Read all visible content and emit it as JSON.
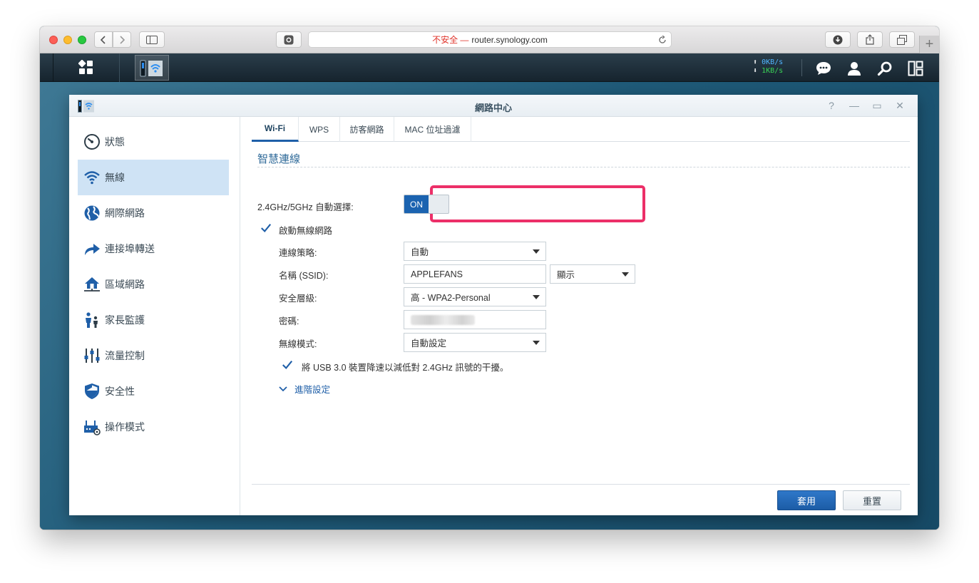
{
  "browser": {
    "url_insecure_label": "不安全 —",
    "url": "router.synology.com",
    "new_tab_label": "+"
  },
  "taskbar": {
    "upload_speed": "0KB/s",
    "download_speed": "1KB/s"
  },
  "app": {
    "title": "網路中心",
    "window_controls": {
      "help": "?",
      "minimize": "—",
      "maximize": "▭",
      "close": "✕"
    }
  },
  "sidebar": {
    "items": [
      {
        "label": "狀態",
        "icon": "gauge-icon"
      },
      {
        "label": "無線",
        "icon": "wifi-icon",
        "active": true
      },
      {
        "label": "網際網路",
        "icon": "globe-icon"
      },
      {
        "label": "連接埠轉送",
        "icon": "forward-arrow-icon"
      },
      {
        "label": "區域網路",
        "icon": "home-network-icon"
      },
      {
        "label": "家長監護",
        "icon": "family-icon"
      },
      {
        "label": "流量控制",
        "icon": "sliders-icon"
      },
      {
        "label": "安全性",
        "icon": "shield-icon"
      },
      {
        "label": "操作模式",
        "icon": "router-gear-icon"
      }
    ]
  },
  "tabs": [
    "Wi-Fi",
    "WPS",
    "訪客網路",
    "MAC 位址過濾"
  ],
  "smart_connect": {
    "section_title": "智慧連線",
    "label": "2.4GHz/5GHz 自動選擇:",
    "toggle_state": "ON"
  },
  "wireless": {
    "enable_label": "啟動無線網路",
    "enabled": true,
    "fields": {
      "strategy_label": "連線策略:",
      "strategy_value": "自動",
      "ssid_label": "名稱 (SSID):",
      "ssid_value": "APPLEFANS",
      "ssid_visibility": "顯示",
      "security_label": "安全層級:",
      "security_value": "高 - WPA2-Personal",
      "password_label": "密碼:",
      "mode_label": "無線模式:",
      "mode_value": "自動設定"
    },
    "usb_option_label": "將 USB 3.0 裝置降速以減低對 2.4GHz 訊號的干擾。",
    "usb_option_checked": true,
    "advanced_label": "進階設定"
  },
  "buttons": {
    "apply": "套用",
    "reset": "重置"
  },
  "colors": {
    "accent": "#1f5fa8",
    "highlight_box": "#ec2f68",
    "active_nav": "#cfe3f5"
  }
}
